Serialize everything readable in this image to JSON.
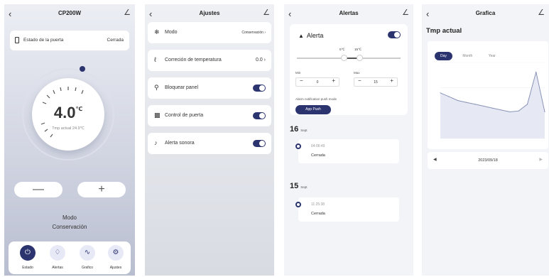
{
  "screen_estado": {
    "title": "CP200W",
    "back_icon": "chevron-left-icon",
    "edit_icon": "edit-pencil-icon",
    "door_label": "Estado de la puerta",
    "door_value": "Cerrada",
    "temperature": "4.0",
    "temperature_unit": "℃",
    "actual_temp": "Tmp actual 24.9℃",
    "minus_label": "—",
    "plus_label": "+",
    "mode_label": "Modo",
    "mode_value": "Conservación",
    "nav": [
      {
        "label": "Estado",
        "icon": "power-icon"
      },
      {
        "label": "Alertas",
        "icon": "bell-icon"
      },
      {
        "label": "Grafico",
        "icon": "chart-icon"
      },
      {
        "label": "Ajustes",
        "icon": "gear-icon"
      }
    ]
  },
  "screen_ajustes": {
    "title": "Ajustes",
    "rows": [
      {
        "label": "Modo",
        "value": "Conservación",
        "icon": "snowflake-icon"
      },
      {
        "label": "Correción de temperatura",
        "value": "0.0",
        "icon": "thermometer-icon"
      },
      {
        "label": "Bloquear panel",
        "icon": "lock-icon",
        "toggle": true
      },
      {
        "label": "Control de puerta",
        "icon": "door-icon",
        "toggle": true
      },
      {
        "label": "Alerta sonora",
        "icon": "speaker-icon",
        "toggle": true
      }
    ]
  },
  "screen_alertas": {
    "title": "Alertas",
    "alert_title": "Alerta",
    "range_low": "0℃",
    "range_high": "15℃",
    "min_label": "Min",
    "max_label": "Max",
    "min_value": "0",
    "max_value": "15",
    "push_mode_label": "Alarm notification push mode",
    "push_button": "App Push",
    "events": [
      {
        "day": "16",
        "month": "Sept",
        "time": "04:06:49",
        "status": "Cerrada"
      },
      {
        "day": "15",
        "month": "Sept",
        "time": "11:25:38",
        "status": "Cerrada"
      }
    ]
  },
  "screen_grafica": {
    "title": "Grafica",
    "graph_title": "Tmp actual",
    "tabs": [
      "Day",
      "Month",
      "Year"
    ],
    "date": "2023/09/18",
    "colors": {
      "line": "#8a93b8",
      "fill": "#e6e9f3",
      "accent": "#2c3470"
    }
  },
  "chart_data": {
    "type": "area",
    "title": "Tmp actual",
    "x": [
      0,
      1,
      2,
      3,
      4,
      5,
      6,
      7,
      8,
      9,
      10,
      11,
      12
    ],
    "values": [
      24,
      22,
      20,
      19,
      18,
      17,
      16,
      15,
      14,
      14.5,
      18,
      35,
      14
    ],
    "grid": true
  }
}
